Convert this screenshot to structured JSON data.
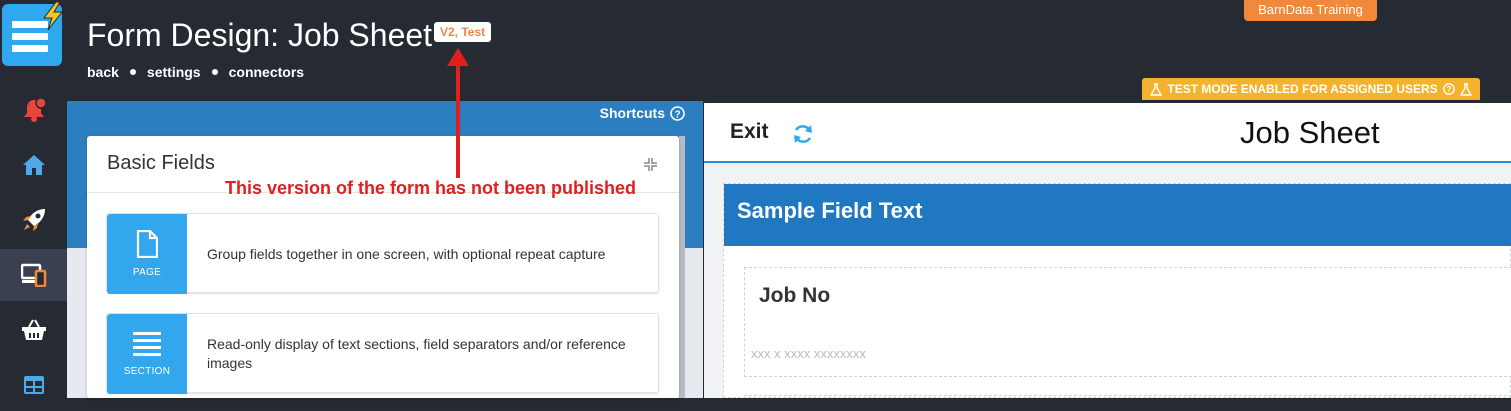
{
  "header": {
    "title": "Form Design: Job Sheet",
    "version_badge": "V2, Test",
    "links": [
      "back",
      "settings",
      "connectors"
    ],
    "training_badge": "BarnData Training",
    "test_mode_badge": "TEST MODE ENABLED FOR ASSIGNED USERS"
  },
  "sidebar": {
    "icons": [
      "app-logo",
      "notifications-bell-icon",
      "home-icon",
      "rocket-icon",
      "devices-icon",
      "basket-icon",
      "dashboard-grid-icon"
    ],
    "colors": {
      "bell": "#e8453c",
      "rocket_accent": "#f08a3a",
      "devices_accent": "#f08a3a",
      "default": "#2ea8ef"
    }
  },
  "left_panel": {
    "shortcuts_label": "Shortcuts",
    "card_title": "Basic Fields",
    "fields": [
      {
        "tile_label": "PAGE",
        "icon": "page-icon",
        "description": "Group fields together in one screen, with optional repeat capture"
      },
      {
        "tile_label": "SECTION",
        "icon": "section-icon",
        "description": "Read-only display of text sections, field separators and/or reference images"
      }
    ]
  },
  "annotation": {
    "text": "This version of the form has not been published",
    "color": "#e01f1f"
  },
  "right_panel": {
    "exit_label": "Exit",
    "form_title": "Job Sheet",
    "section_header": "Sample Field Text",
    "field_label": "Job No",
    "field_placeholder": "xxx x xxxx xxxxxxxx"
  },
  "colors": {
    "topbar": "#252a33",
    "primary_blue": "#2b7fc1",
    "section_blue": "#1f78c1",
    "tile_blue": "#33a7ee",
    "orange": "#f08a3a",
    "warning_yellow": "#f5b32d"
  }
}
